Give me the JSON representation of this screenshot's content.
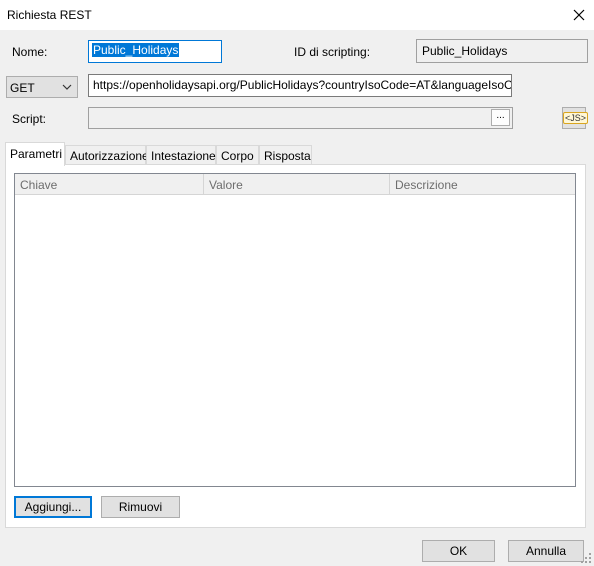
{
  "window": {
    "title": "Richiesta REST"
  },
  "form": {
    "name_label": "Nome:",
    "name_value": "Public_Holidays",
    "scripting_id_label": "ID di scripting:",
    "scripting_id_value": "Public_Holidays",
    "method_value": "GET",
    "url_value": "https://openholidaysapi.org/PublicHolidays?countryIsoCode=AT&languageIsoCode=EN",
    "script_label": "Script:",
    "script_value": "",
    "browse_label": "...",
    "js_label": "<JS>"
  },
  "tabs": [
    {
      "label": "Parametri",
      "active": true
    },
    {
      "label": "Autorizzazione",
      "active": false
    },
    {
      "label": "Intestazione",
      "active": false
    },
    {
      "label": "Corpo",
      "active": false
    },
    {
      "label": "Risposta",
      "active": false
    }
  ],
  "params_table": {
    "columns": [
      "Chiave",
      "Valore",
      "Descrizione"
    ],
    "rows": []
  },
  "buttons": {
    "add": "Aggiungi...",
    "remove": "Rimuovi",
    "ok": "OK",
    "cancel": "Annulla"
  },
  "colors": {
    "accent": "#0078d7",
    "dialog_bg": "#f0f0f0"
  },
  "icons": {
    "close": "close-icon",
    "dropdown": "chevron-down-icon",
    "resize": "resize-grip-icon"
  }
}
